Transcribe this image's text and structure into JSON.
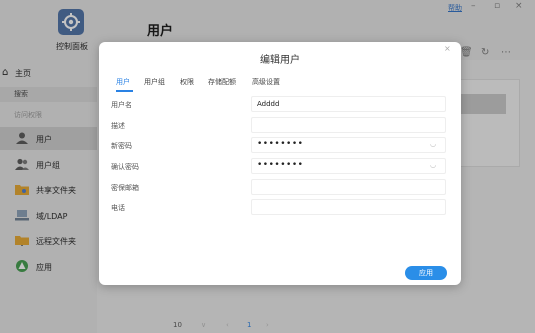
{
  "app": {
    "control_panel_label": "控制面板",
    "page_title": "用户",
    "help_link": "帮助",
    "window_controls": [
      "–",
      "▫",
      "×"
    ]
  },
  "sidebar": {
    "home": "主页",
    "search": "搜索",
    "section": "访问权限",
    "items": [
      {
        "label": "用户",
        "icon": "user-icon",
        "active": true
      },
      {
        "label": "用户组",
        "icon": "user-group-icon",
        "active": false
      },
      {
        "label": "共享文件夹",
        "icon": "shared-folder-icon",
        "active": false
      },
      {
        "label": "域/LDAP",
        "icon": "domain-ldap-icon",
        "active": false
      },
      {
        "label": "远程文件夹",
        "icon": "remote-folder-icon",
        "active": false
      },
      {
        "label": "应用",
        "icon": "apps-icon",
        "active": false
      }
    ]
  },
  "pager": {
    "page_size": "10",
    "current_page": "1"
  },
  "dialog": {
    "title": "编辑用户",
    "close": "×",
    "tabs": [
      {
        "label": "用户",
        "active": true
      },
      {
        "label": "用户组",
        "active": false
      },
      {
        "label": "权限",
        "active": false
      },
      {
        "label": "存储配额",
        "active": false
      },
      {
        "label": "高级设置",
        "active": false
      }
    ],
    "fields": {
      "username": {
        "label": "用户名",
        "value": "Adddd"
      },
      "description": {
        "label": "描述",
        "value": ""
      },
      "new_password": {
        "label": "新密码",
        "value": "••••••••"
      },
      "confirm_password": {
        "label": "确认密码",
        "value": "••••••••"
      },
      "email": {
        "label": "密保邮箱",
        "value": ""
      },
      "phone": {
        "label": "电话",
        "value": ""
      }
    },
    "apply_button": "应用"
  },
  "colors": {
    "accent": "#2a82e4",
    "apply": "#2a8ee8"
  }
}
